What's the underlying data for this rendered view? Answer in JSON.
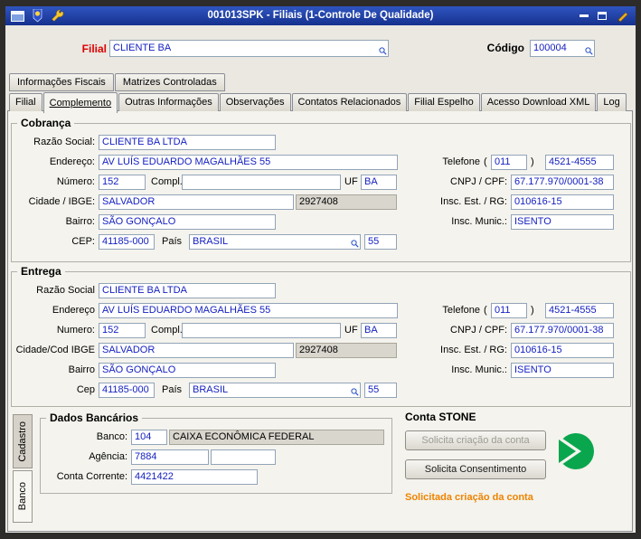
{
  "titlebar": {
    "title": "001013SPK - Filiais (1-Controle De Qualidade)"
  },
  "header": {
    "filial_label": "Filial",
    "filial_value": "CLIENTE BA",
    "codigo_label": "Código",
    "codigo_value": "100004"
  },
  "tabs_top": [
    {
      "label": "Informações Fiscais"
    },
    {
      "label": "Matrizes Controladas"
    }
  ],
  "tabs_main": [
    {
      "label": "Filial"
    },
    {
      "label": "Complemento"
    },
    {
      "label": "Outras Informações"
    },
    {
      "label": "Observações"
    },
    {
      "label": "Contatos Relacionados"
    },
    {
      "label": "Filial Espelho"
    },
    {
      "label": "Acesso Download XML"
    },
    {
      "label": "Log"
    }
  ],
  "cobranca": {
    "title": "Cobrança",
    "razao_label": "Razão Social:",
    "razao": "CLIENTE BA LTDA",
    "endereco_label": "Endereço:",
    "endereco": "AV LUÍS EDUARDO MAGALHÃES 55",
    "numero_label": "Número:",
    "numero": "152",
    "compl_label": "Compl.",
    "compl": "",
    "uf_label": "UF",
    "uf": "BA",
    "cidade_label": "Cidade / IBGE:",
    "cidade": "SALVADOR",
    "ibge": "2927408",
    "bairro_label": "Bairro:",
    "bairro": "SÃO GONÇALO",
    "cep_label": "CEP:",
    "cep": "41185-000",
    "pais_label": "País",
    "pais": "BRASIL",
    "ddi": "55",
    "telefone_label": "Telefone",
    "paren_open": "(",
    "ddd": "011",
    "paren_close": ")",
    "telefone": "4521-4555",
    "cnpj_label": "CNPJ / CPF:",
    "cnpj": "67.177.970/0001-38",
    "insc_est_label": "Insc. Est. / RG:",
    "insc_est": "010616-15",
    "insc_mun_label": "Insc. Munic.:",
    "insc_mun": "ISENTO"
  },
  "entrega": {
    "title": "Entrega",
    "razao_label": "Razão Social",
    "razao": "CLIENTE BA LTDA",
    "endereco_label": "Endereço",
    "endereco": "AV LUÍS EDUARDO MAGALHÃES 55",
    "numero_label": "Numero:",
    "numero": "152",
    "compl_label": "Compl.",
    "compl": "",
    "uf_label": "UF",
    "uf": "BA",
    "cidade_label": "Cidade/Cod IBGE",
    "cidade": "SALVADOR",
    "ibge": "2927408",
    "bairro_label": "Bairro",
    "bairro": "SÃO GONÇALO",
    "cep_label": "Cep",
    "cep": "41185-000",
    "pais_label": "País",
    "pais": "BRASIL",
    "ddi": "55",
    "telefone_label": "Telefone",
    "paren_open": "(",
    "ddd": "011",
    "paren_close": ")",
    "telefone": "4521-4555",
    "cnpj_label": "CNPJ / CPF:",
    "cnpj": "67.177.970/0001-38",
    "insc_est_label": "Insc. Est. / RG:",
    "insc_est": "010616-15",
    "insc_mun_label": "Insc. Munic.:",
    "insc_mun": "ISENTO"
  },
  "side_tabs": [
    {
      "label": "Cadastro"
    },
    {
      "label": "Banco"
    }
  ],
  "dados_bancarios": {
    "title": "Dados Bancários",
    "banco_label": "Banco:",
    "banco_codigo": "104",
    "banco_nome": "CAIXA ECONÔMICA FEDERAL",
    "agencia_label": "Agência:",
    "agencia": "7884",
    "agencia_digito": "",
    "conta_label": "Conta Corrente:",
    "conta": "4421422"
  },
  "conta_stone": {
    "title": "Conta STONE",
    "solicita_criacao_button": "Solicita criação da conta",
    "solicita_consentimento_button": "Solicita Consentimento",
    "status": "Solicitada criação da conta"
  },
  "colors": {
    "titlebar_blue": "#2f55c0",
    "field_text_blue": "#1520c0",
    "filial_label_red": "#dd0000",
    "status_orange": "#ef8300",
    "stone_green": "#0aa64e"
  }
}
